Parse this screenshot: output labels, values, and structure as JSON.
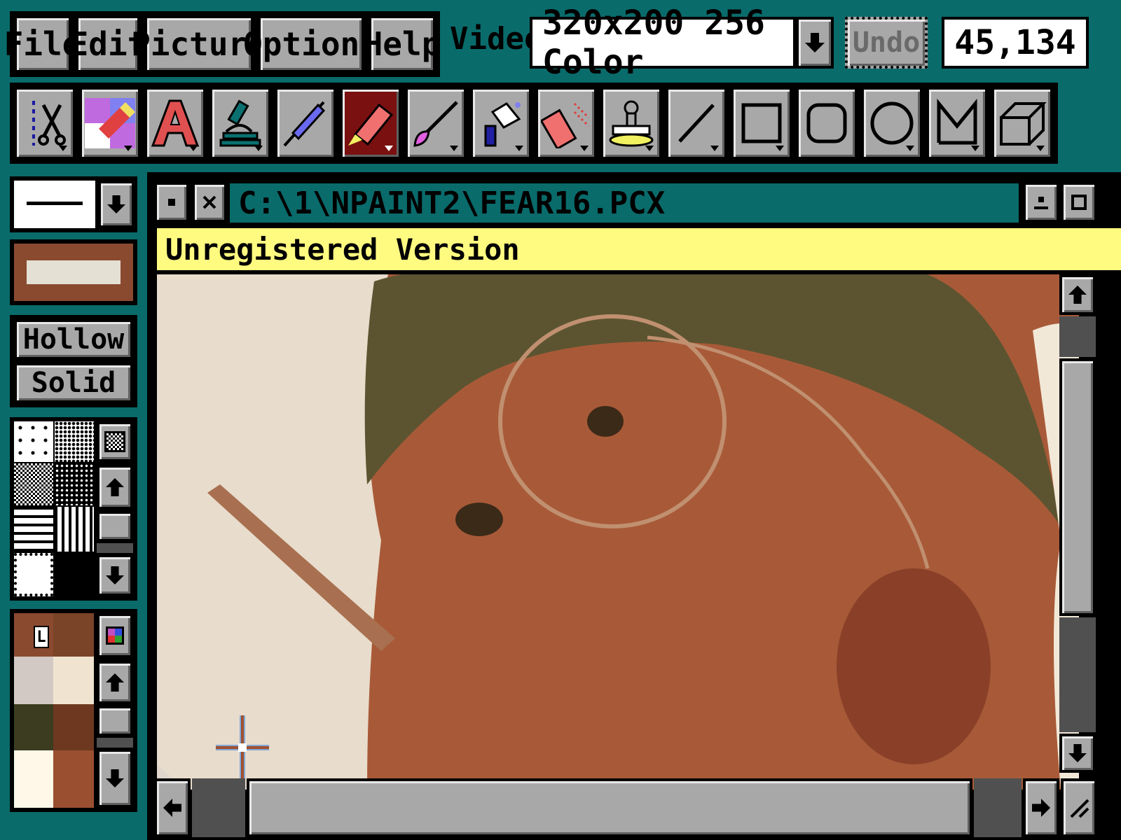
{
  "menu": {
    "file": "File",
    "edit": "Edit",
    "picture": "Picture",
    "options": "Options",
    "help": "Help"
  },
  "video": {
    "label": "Video:",
    "mode": "320x200 256 Color"
  },
  "undo_label": "Undo",
  "coordinates": "45,134",
  "tools": [
    "cut-icon",
    "color-replace-icon",
    "text-icon",
    "microscope-icon",
    "pen-icon",
    "marker-icon",
    "brush-icon",
    "airbrush-icon",
    "spray-icon",
    "stamp-icon",
    "line-icon",
    "rectangle-icon",
    "rounded-rectangle-icon",
    "ellipse-icon",
    "polygon-icon",
    "box3d-icon"
  ],
  "fill_buttons": {
    "hollow": "Hollow",
    "solid": "Solid"
  },
  "palette_label": "L",
  "document": {
    "path": "C:\\1\\NPAINT2\\FEAR16.PCX",
    "banner": "Unregistered Version"
  },
  "colors": {
    "desktop": "#0a6b6b",
    "titlebar": "#0a6b6b",
    "banner": "#fffa80",
    "palette": [
      "#8a4a30",
      "#7a4428",
      "#d2c8c4",
      "#f0e4d0",
      "#3c3c20",
      "#6e3820",
      "#fff8e8",
      "#9a5030"
    ]
  }
}
